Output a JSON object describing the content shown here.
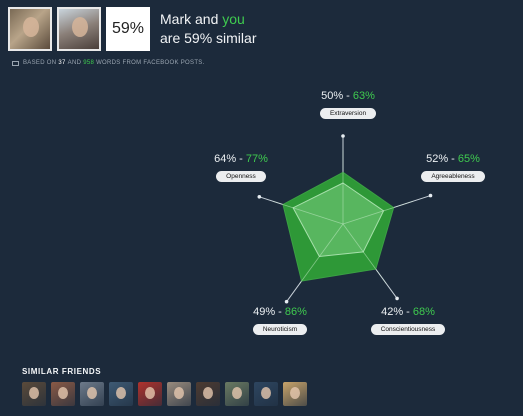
{
  "header": {
    "mark_photo_alt": "Mark",
    "you_photo_alt": "you",
    "similarity_pct": "59%",
    "title_line1_name": "Mark",
    "title_line1_and": "and",
    "title_line1_you": "you",
    "title_line2": "are 59% similar"
  },
  "basis": {
    "prefix": "BASED ON",
    "count_a": "37",
    "and": "AND",
    "count_b": "958",
    "suffix": "WORDS FROM FACEBOOK POSTS."
  },
  "traits": [
    {
      "label": "Extraversion",
      "mark": "50%",
      "sep": " - ",
      "you": "63%"
    },
    {
      "label": "Agreeableness",
      "mark": "52%",
      "sep": " - ",
      "you": "65%"
    },
    {
      "label": "Conscientiousness",
      "mark": "42%",
      "sep": " - ",
      "you": "68%"
    },
    {
      "label": "Neuroticism",
      "mark": "49%",
      "sep": " - ",
      "you": "86%"
    },
    {
      "label": "Openness",
      "mark": "64%",
      "sep": " - ",
      "you": "77%"
    }
  ],
  "radar": {
    "mark_values": [
      0.5,
      0.52,
      0.42,
      0.49,
      0.64
    ],
    "you_values": [
      0.63,
      0.65,
      0.68,
      0.86,
      0.77
    ],
    "you_color": "#2f9e37",
    "mark_color": "#7bd081",
    "line_color": "#c9d2da"
  },
  "similar_friends": {
    "title": "SIMILAR FRIENDS",
    "friends": [
      {
        "color": "#5a4a3a"
      },
      {
        "color": "#8a5a46"
      },
      {
        "color": "#6d7a8a"
      },
      {
        "color": "#3e5a74"
      },
      {
        "color": "#b0322c"
      },
      {
        "color": "#9a8c7e"
      },
      {
        "color": "#4d3b31"
      },
      {
        "color": "#6a7a62"
      },
      {
        "color": "#2e4660"
      },
      {
        "color": "#c9a46a"
      }
    ]
  }
}
